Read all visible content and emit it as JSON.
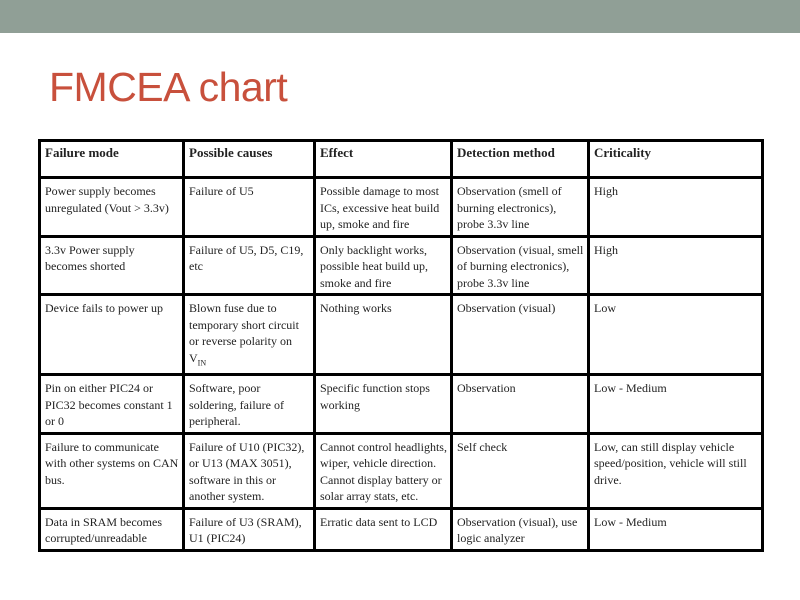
{
  "slide": {
    "title": "FMCEA chart",
    "colors": {
      "top_bar": "#909f96",
      "title": "#c8503c"
    }
  },
  "table": {
    "headers": [
      "Failure mode",
      "Possible causes",
      "Effect",
      "Detection method",
      "Criticality"
    ],
    "rows": [
      {
        "failure_mode": "Power supply becomes unregulated (Vout > 3.3v)",
        "possible_causes": "Failure of U5",
        "effect": "Possible damage to most ICs, excessive heat build up, smoke and fire",
        "detection_method": "Observation (smell of burning electronics), probe 3.3v line",
        "criticality": "High"
      },
      {
        "failure_mode": "3.3v Power supply becomes shorted",
        "possible_causes": "Failure of U5, D5, C19, etc",
        "effect": "Only backlight works, possible heat build up, smoke and fire",
        "detection_method": "Observation (visual, smell of burning electronics), probe 3.3v line",
        "criticality": "High"
      },
      {
        "failure_mode": "Device fails to power up",
        "possible_causes": "Blown fuse due to temporary short circuit or reverse polarity on V",
        "possible_causes_subscript": "IN",
        "effect": "Nothing works",
        "detection_method": "Observation (visual)",
        "criticality": "Low"
      },
      {
        "failure_mode": "Pin on either PIC24 or PIC32 becomes constant 1 or 0",
        "possible_causes": "Software, poor soldering, failure of peripheral.",
        "effect": "Specific function stops working",
        "detection_method": "Observation",
        "criticality": "Low - Medium"
      },
      {
        "failure_mode": "Failure to communicate with other systems on CAN bus.",
        "possible_causes": "Failure of U10 (PIC32), or U13 (MAX 3051), software in this or another system.",
        "effect": "Cannot control headlights, wiper, vehicle direction. Cannot display battery or solar array stats, etc.",
        "detection_method": "Self check",
        "criticality": "Low, can still display vehicle speed/position, vehicle will still drive."
      },
      {
        "failure_mode": "Data in SRAM becomes corrupted/unreadable",
        "possible_causes": "Failure of U3 (SRAM), U1 (PIC24)",
        "effect": "Erratic data sent to LCD",
        "detection_method": "Observation (visual), use logic analyzer",
        "criticality": "Low - Medium"
      }
    ]
  }
}
